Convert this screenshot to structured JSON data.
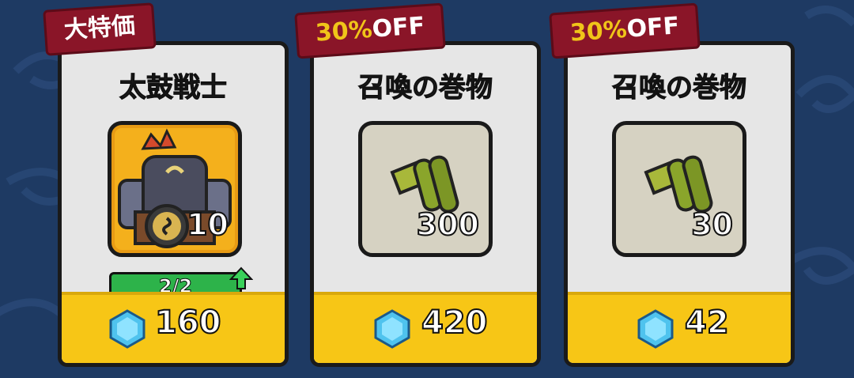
{
  "offers": [
    {
      "badge": "大特価",
      "title": "太鼓戦士",
      "quantity": "10",
      "level": "2/2",
      "price": "160",
      "icon": "taiko-warrior-icon"
    },
    {
      "badge_pct": "30%",
      "badge_off": "OFF",
      "title": "召喚の巻物",
      "quantity": "300",
      "price": "420",
      "icon": "scroll-icon"
    },
    {
      "badge_pct": "30%",
      "badge_off": "OFF",
      "title": "召喚の巻物",
      "quantity": "30",
      "price": "42",
      "icon": "scroll-icon"
    }
  ],
  "colors": {
    "background": "#1e3a63",
    "card": "#e6e6e6",
    "price_bar": "#f7c616",
    "ribbon": "#8a1528",
    "discount_text": "#f0c419",
    "level_bar": "#2db34a"
  },
  "currency_icon": "blue-gem-icon"
}
